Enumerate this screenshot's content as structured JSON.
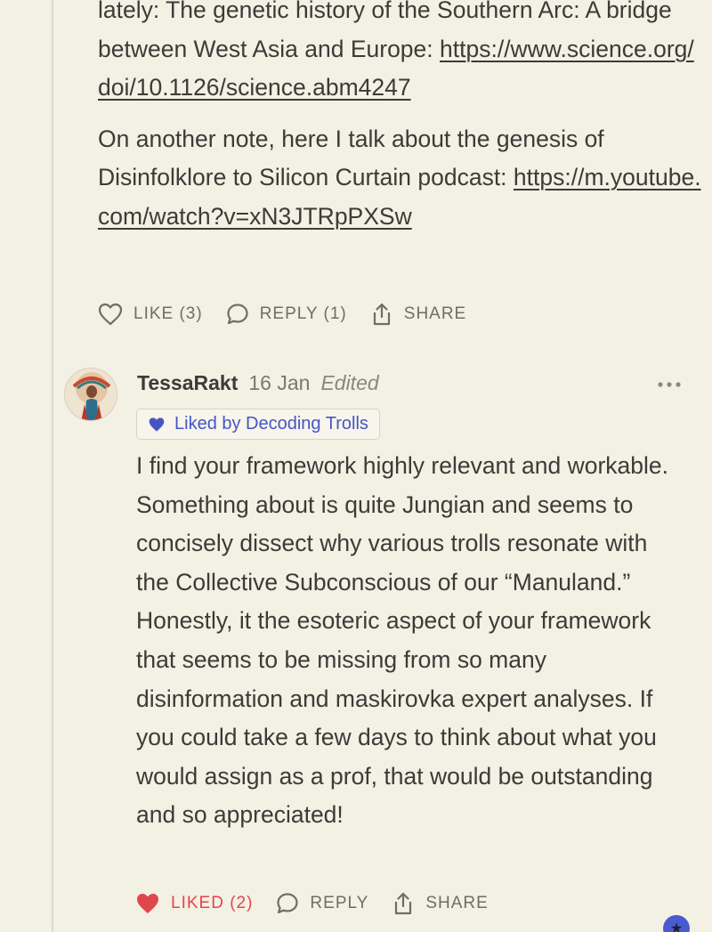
{
  "comment1": {
    "paragraph1_prefix": "lately: The genetic history of the Southern Arc: A bridge between West Asia and Europe: ",
    "paragraph1_link": "https://www.science.org/doi/10.1126/science.abm4247",
    "paragraph2_prefix": "On another note, here I talk about the genesis of Disinfolklore to Silicon Curtain podcast: ",
    "paragraph2_link": "https://m.youtube.com/watch?v=xN3JTRpPXSw",
    "actions": {
      "like": "LIKE (3)",
      "reply": "REPLY (1)",
      "share": "SHARE"
    }
  },
  "reply": {
    "author": "TessaRakt",
    "date": "16 Jan",
    "edited": "Edited",
    "liked_by": "Liked by Decoding Trolls",
    "body": "I find your framework highly relevant and workable. Something about is quite Jungian and seems to concisely dissect why various trolls resonate with the Collective Subconscious of our “Manuland.” Honestly, it the esoteric aspect of your framework that seems to be missing from so many disinformation and maskirovka expert analyses. If you could take a few days to think about what you would assign as a prof, that would be outstanding and so appreciated!",
    "actions": {
      "liked": "LIKED (2)",
      "reply": "REPLY",
      "share": "SHARE"
    }
  },
  "colors": {
    "background": "#f3f0e4",
    "text": "#3c3b37",
    "muted": "#6f6d66",
    "liked_red": "#e0474c",
    "badge_blue": "#4556c4"
  },
  "icons": [
    "heart-outline-icon",
    "comment-bubble-icon",
    "share-icon",
    "heart-filled-icon",
    "blue-heart-icon",
    "more-dots-icon"
  ]
}
